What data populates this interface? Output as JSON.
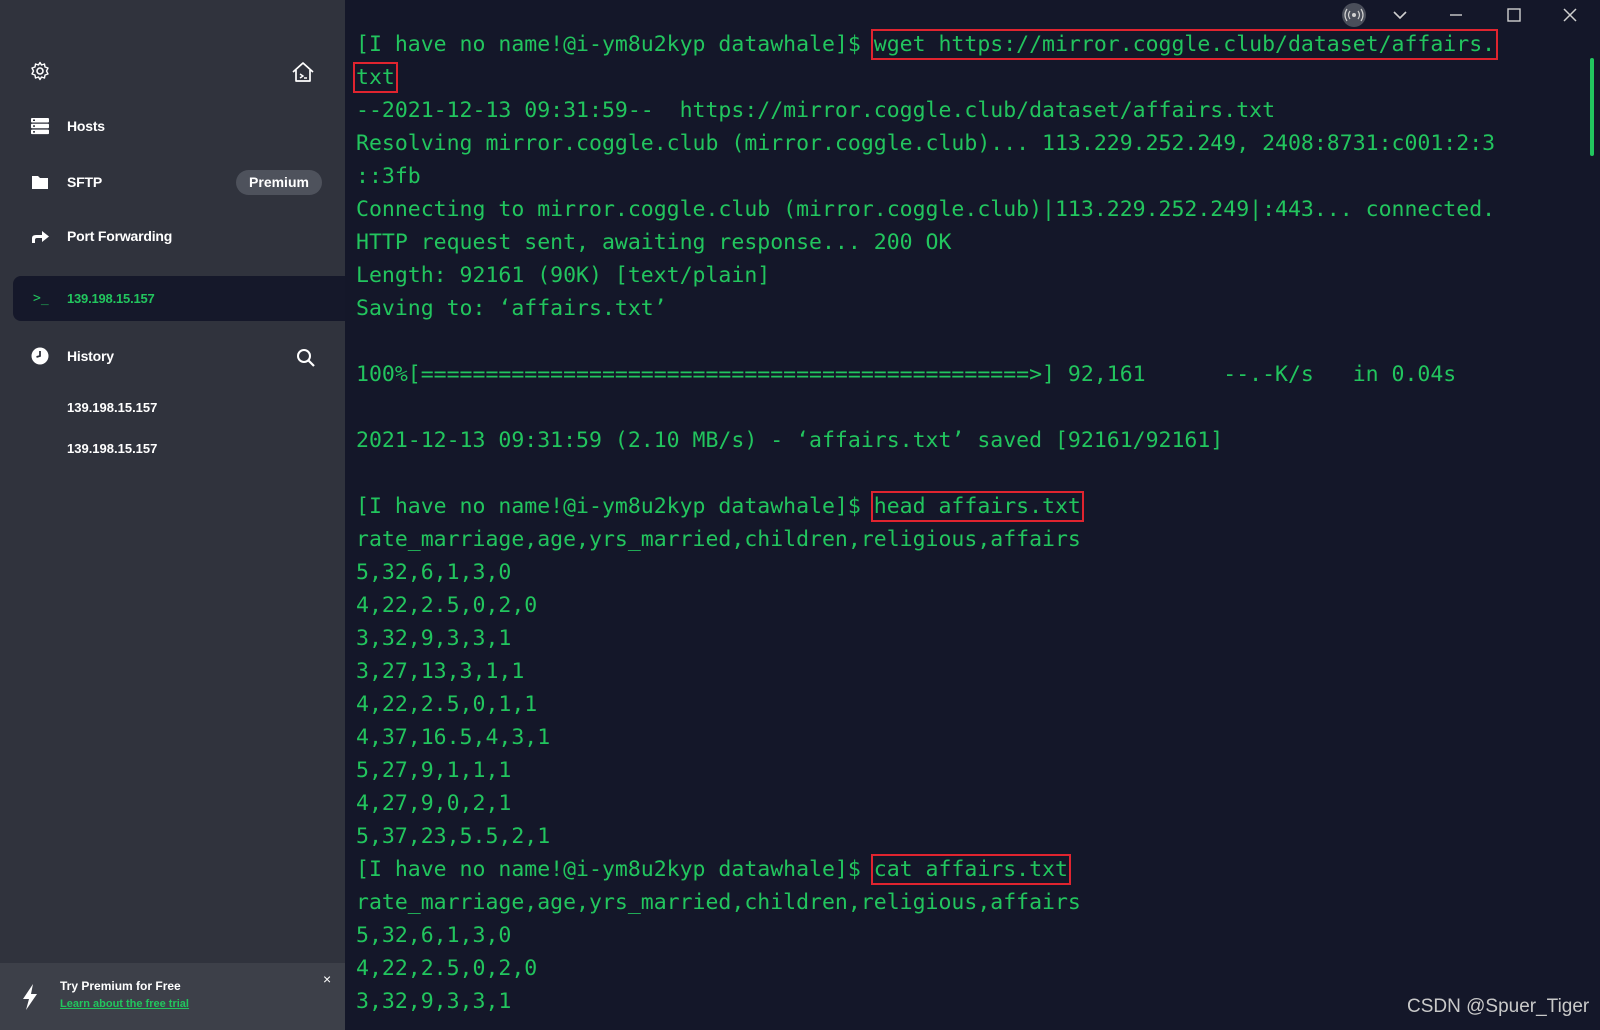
{
  "sidebar": {
    "nav": {
      "hosts": "Hosts",
      "sftp": "SFTP",
      "port_forwarding": "Port Forwarding"
    },
    "premium_badge": "Premium",
    "active_session": {
      "prompt": ">_",
      "label": "139.198.15.157"
    },
    "history": {
      "title": "History",
      "items": [
        "139.198.15.157",
        "139.198.15.157"
      ]
    },
    "promo": {
      "title": "Try Premium for Free",
      "link": "Learn about the free trial",
      "close": "×"
    }
  },
  "terminal": {
    "lines": [
      {
        "text": "[I have no name!@i-ym8u2kyp datawhale]$ ",
        "hl": "wget https://mirror.coggle.club/dataset/affairs."
      },
      {
        "text": "",
        "hl": "txt"
      },
      {
        "text": "--2021-12-13 09:31:59--  https://mirror.coggle.club/dataset/affairs.txt"
      },
      {
        "text": "Resolving mirror.coggle.club (mirror.coggle.club)... 113.229.252.249, 2408:8731:c001:2:3"
      },
      {
        "text": "::3fb"
      },
      {
        "text": "Connecting to mirror.coggle.club (mirror.coggle.club)|113.229.252.249|:443... connected."
      },
      {
        "text": "HTTP request sent, awaiting response... 200 OK"
      },
      {
        "text": "Length: 92161 (90K) [text/plain]"
      },
      {
        "text": "Saving to: ‘affairs.txt’"
      },
      {
        "text": ""
      },
      {
        "text": "100%[===============================================>] 92,161      --.-K/s   in 0.04s"
      },
      {
        "text": ""
      },
      {
        "text": "2021-12-13 09:31:59 (2.10 MB/s) - ‘affairs.txt’ saved [92161/92161]"
      },
      {
        "text": ""
      },
      {
        "text": "[I have no name!@i-ym8u2kyp datawhale]$ ",
        "hl": "head affairs.txt"
      },
      {
        "text": "rate_marriage,age,yrs_married,children,religious,affairs"
      },
      {
        "text": "5,32,6,1,3,0"
      },
      {
        "text": "4,22,2.5,0,2,0"
      },
      {
        "text": "3,32,9,3,3,1"
      },
      {
        "text": "3,27,13,3,1,1"
      },
      {
        "text": "4,22,2.5,0,1,1"
      },
      {
        "text": "4,37,16.5,4,3,1"
      },
      {
        "text": "5,27,9,1,1,1"
      },
      {
        "text": "4,27,9,0,2,1"
      },
      {
        "text": "5,37,23,5.5,2,1"
      },
      {
        "text": "[I have no name!@i-ym8u2kyp datawhale]$ ",
        "hl": "cat affairs.txt"
      },
      {
        "text": "rate_marriage,age,yrs_married,children,religious,affairs"
      },
      {
        "text": "5,32,6,1,3,0"
      },
      {
        "text": "4,22,2.5,0,2,0"
      },
      {
        "text": "3,32,9,3,3,1"
      }
    ]
  },
  "watermark": "CSDN @Spuer_Tiger",
  "colors": {
    "terminal_bg": "#141729",
    "sidebar_bg": "#30333d",
    "terminal_text": "#22c55e",
    "highlight_box": "#e0242f"
  },
  "icons": [
    "gear-icon",
    "home-icon",
    "hosts-icon",
    "folder-icon",
    "port-forwarding-icon",
    "terminal-icon",
    "clock-icon",
    "search-icon",
    "lightning-icon",
    "broadcast-icon",
    "chevron-down-icon",
    "minimize-icon",
    "maximize-icon",
    "close-icon"
  ]
}
